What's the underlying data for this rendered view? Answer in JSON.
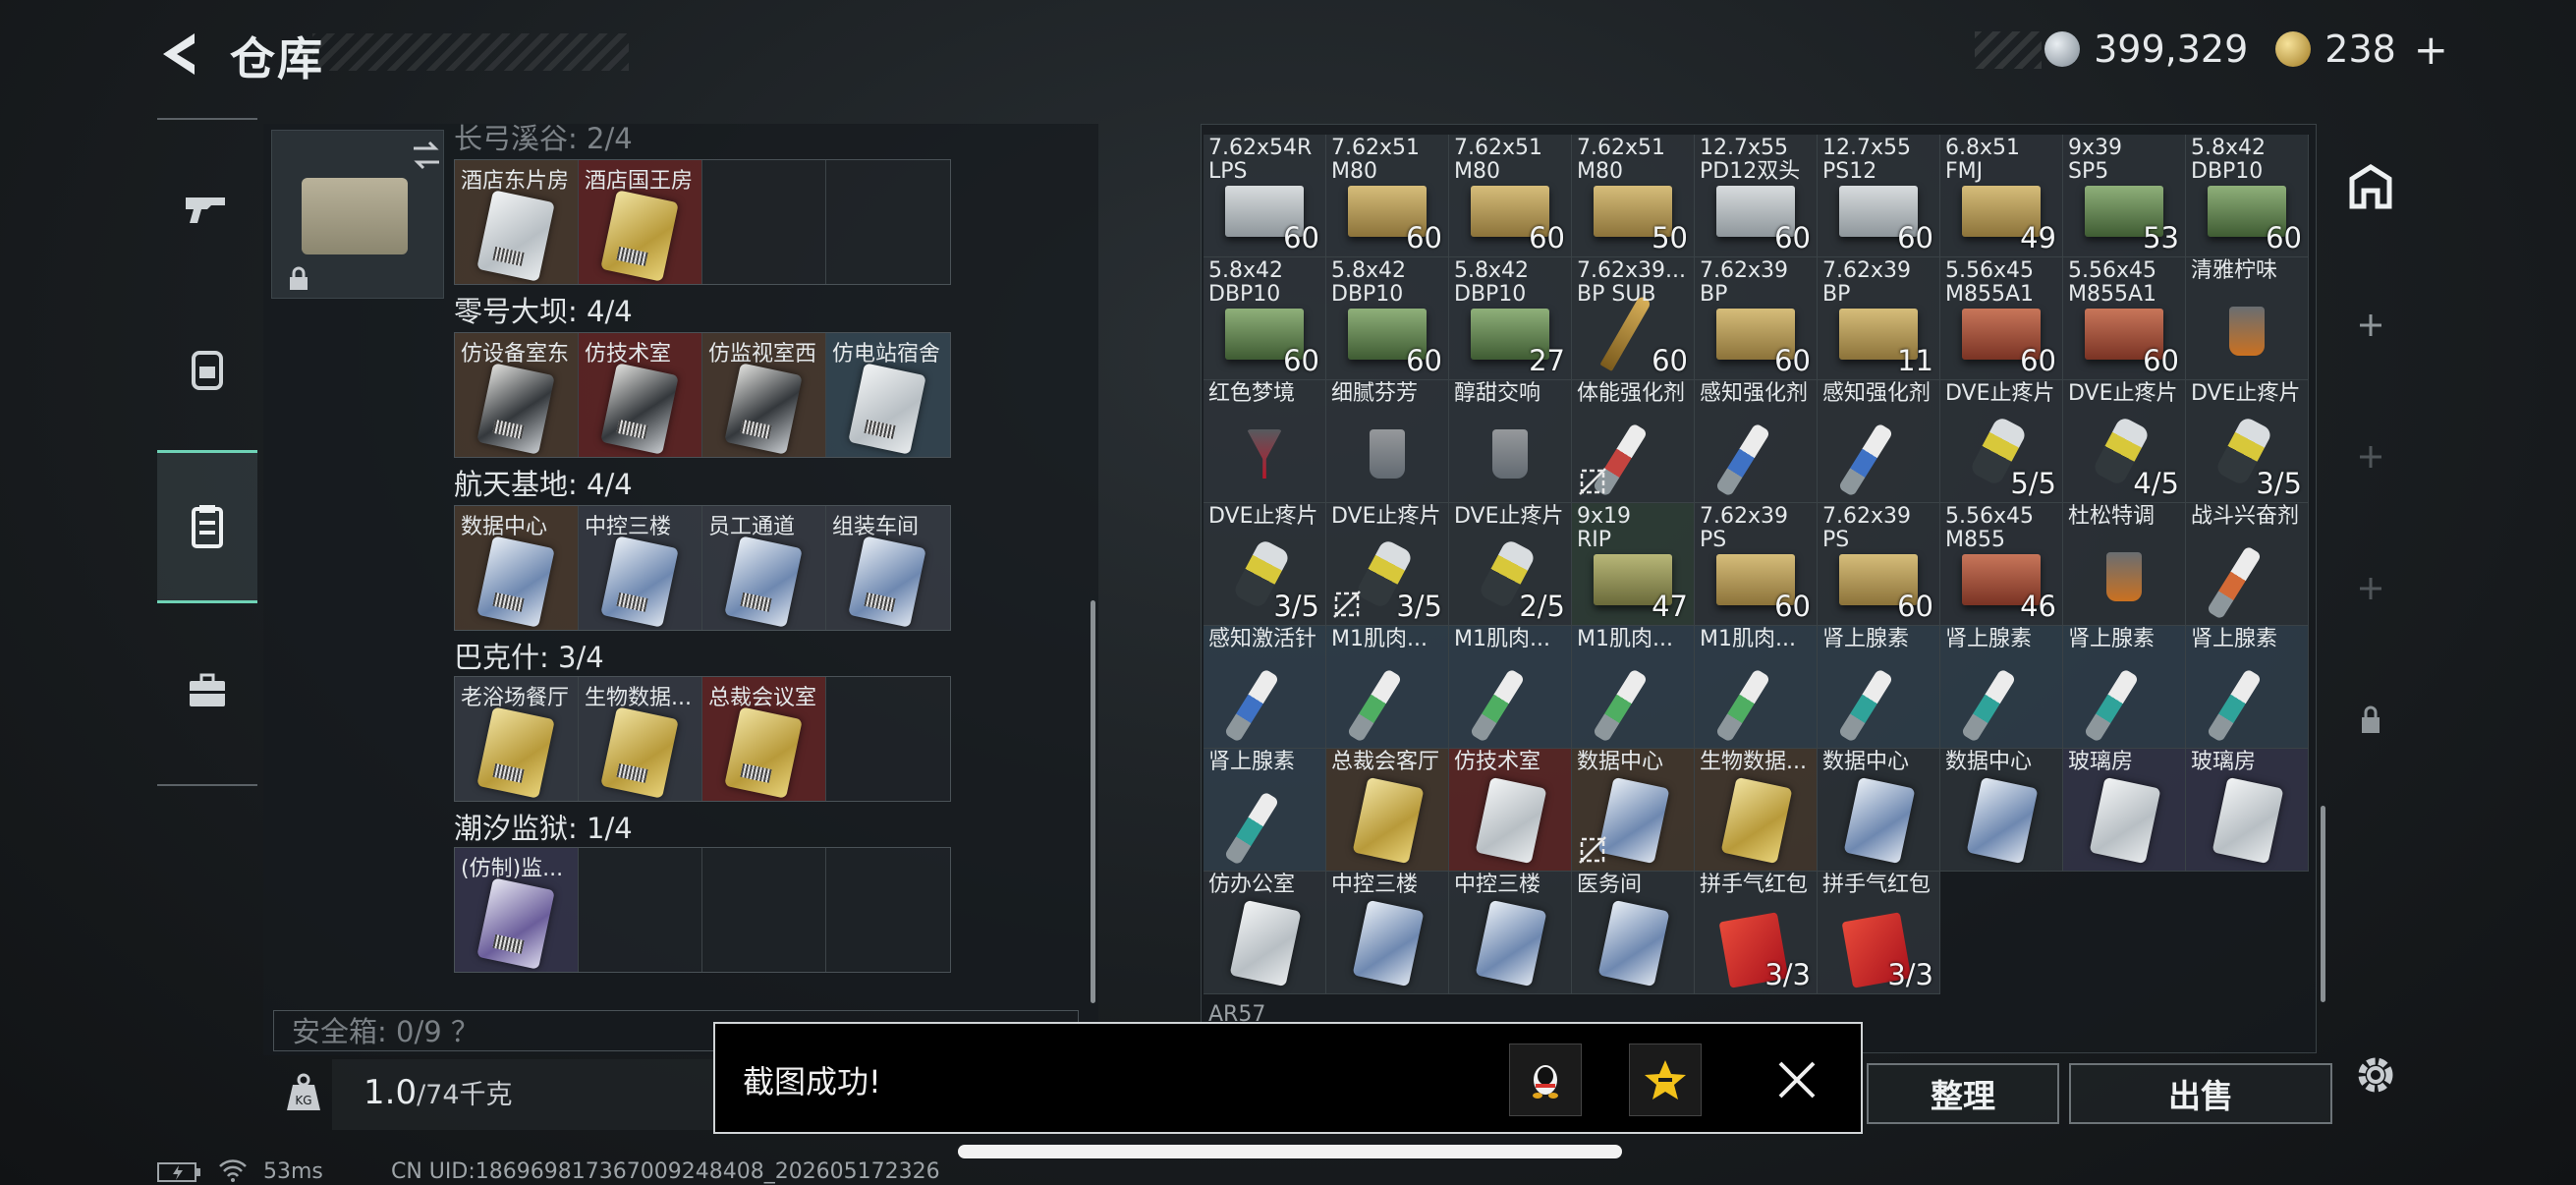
{
  "header": {
    "title": "仓库",
    "silver_amount": "399,329",
    "gold_amount": "238",
    "gold_plus": "+"
  },
  "left": {
    "section_top_partial": "长弓溪谷: 2/4",
    "sections": [
      {
        "label": "零号大坝: 4/4",
        "cards": [
          "仿设备室东",
          "仿技术室",
          "仿监视室西",
          "仿电站宿舍"
        ]
      },
      {
        "label": "航天基地: 4/4",
        "cards": [
          "数据中心",
          "中控三楼",
          "员工通道",
          "组装车间"
        ]
      },
      {
        "label": "巴克什: 3/4",
        "cards": [
          "老浴场餐厅",
          "生物数据...",
          "总裁会议室",
          ""
        ]
      },
      {
        "label": "潮汐监狱: 1/4",
        "cards": [
          "(仿制)监...",
          "",
          "",
          ""
        ]
      }
    ],
    "first_row_cards": [
      "酒店东片房",
      "酒店国王房",
      "",
      ""
    ],
    "safe_box_label": "安全箱: 0/9 ？",
    "weight_value": "1.0",
    "weight_unit": "/74千克"
  },
  "grid": {
    "rows": [
      [
        {
          "n": "7.62x54R\nLPS",
          "c": "60"
        },
        {
          "n": "7.62x51\nM80",
          "c": "60"
        },
        {
          "n": "7.62x51\nM80",
          "c": "60"
        },
        {
          "n": "7.62x51\nM80",
          "c": "50"
        },
        {
          "n": "12.7x55\nPD12双头",
          "c": "60"
        },
        {
          "n": "12.7x55\nPS12",
          "c": "60"
        },
        {
          "n": "6.8x51\nFMJ",
          "c": "49"
        },
        {
          "n": "9x39\nSP5",
          "c": "53"
        },
        {
          "n": "5.8x42\nDBP10",
          "c": "60"
        }
      ],
      [
        {
          "n": "5.8x42\nDBP10",
          "c": "60"
        },
        {
          "n": "5.8x42\nDBP10",
          "c": "60"
        },
        {
          "n": "5.8x42\nDBP10",
          "c": "27"
        },
        {
          "n": "7.62x39...\nBP SUB",
          "c": "60"
        },
        {
          "n": "7.62x39\nBP",
          "c": "60"
        },
        {
          "n": "7.62x39\nBP",
          "c": "11"
        },
        {
          "n": "5.56x45\nM855A1",
          "c": "60"
        },
        {
          "n": "5.56x45\nM855A1",
          "c": "60"
        },
        {
          "n": "清雅柠味",
          "c": ""
        }
      ],
      [
        {
          "n": "红色梦境",
          "c": ""
        },
        {
          "n": "细腻芬芳",
          "c": ""
        },
        {
          "n": "醇甜交响",
          "c": ""
        },
        {
          "n": "体能强化剂",
          "c": ""
        },
        {
          "n": "感知强化剂",
          "c": ""
        },
        {
          "n": "感知强化剂",
          "c": ""
        },
        {
          "n": "DVE止疼片",
          "c": "5/5"
        },
        {
          "n": "DVE止疼片",
          "c": "4/5"
        },
        {
          "n": "DVE止疼片",
          "c": "3/5"
        }
      ],
      [
        {
          "n": "DVE止疼片",
          "c": "3/5"
        },
        {
          "n": "DVE止疼片",
          "c": "3/5"
        },
        {
          "n": "DVE止疼片",
          "c": "2/5"
        },
        {
          "n": "9x19\nRIP",
          "c": "47"
        },
        {
          "n": "7.62x39\nPS",
          "c": "60"
        },
        {
          "n": "7.62x39\nPS",
          "c": "60"
        },
        {
          "n": "5.56x45\nM855",
          "c": "46"
        },
        {
          "n": "杜松特调",
          "c": ""
        },
        {
          "n": "战斗兴奋剂",
          "c": ""
        }
      ],
      [
        {
          "n": "感知激活针",
          "c": ""
        },
        {
          "n": "M1肌肉...",
          "c": ""
        },
        {
          "n": "M1肌肉...",
          "c": ""
        },
        {
          "n": "M1肌肉...",
          "c": ""
        },
        {
          "n": "M1肌肉...",
          "c": ""
        },
        {
          "n": "肾上腺素",
          "c": ""
        },
        {
          "n": "肾上腺素",
          "c": ""
        },
        {
          "n": "肾上腺素",
          "c": ""
        },
        {
          "n": "肾上腺素",
          "c": ""
        }
      ],
      [
        {
          "n": "肾上腺素",
          "c": ""
        },
        {
          "n": "总裁会客厅",
          "c": ""
        },
        {
          "n": "仿技术室",
          "c": ""
        },
        {
          "n": "数据中心",
          "c": ""
        },
        {
          "n": "生物数据...",
          "c": ""
        },
        {
          "n": "数据中心",
          "c": ""
        },
        {
          "n": "数据中心",
          "c": ""
        },
        {
          "n": "玻璃房",
          "c": ""
        },
        {
          "n": "玻璃房",
          "c": ""
        }
      ],
      [
        {
          "n": "仿办公室",
          "c": ""
        },
        {
          "n": "中控三楼",
          "c": ""
        },
        {
          "n": "中控三楼",
          "c": ""
        },
        {
          "n": "医务间",
          "c": ""
        },
        {
          "n": "拼手气红包",
          "c": "3/3"
        },
        {
          "n": "拼手气红包",
          "c": "3/3"
        }
      ]
    ],
    "peek_label": "AR57"
  },
  "buttons": {
    "organize": "整理",
    "sell": "出售"
  },
  "toast": {
    "text": "截图成功!"
  },
  "status": {
    "ping": "53ms",
    "uid": "CN UID:186969817367009248408_202605172326"
  }
}
